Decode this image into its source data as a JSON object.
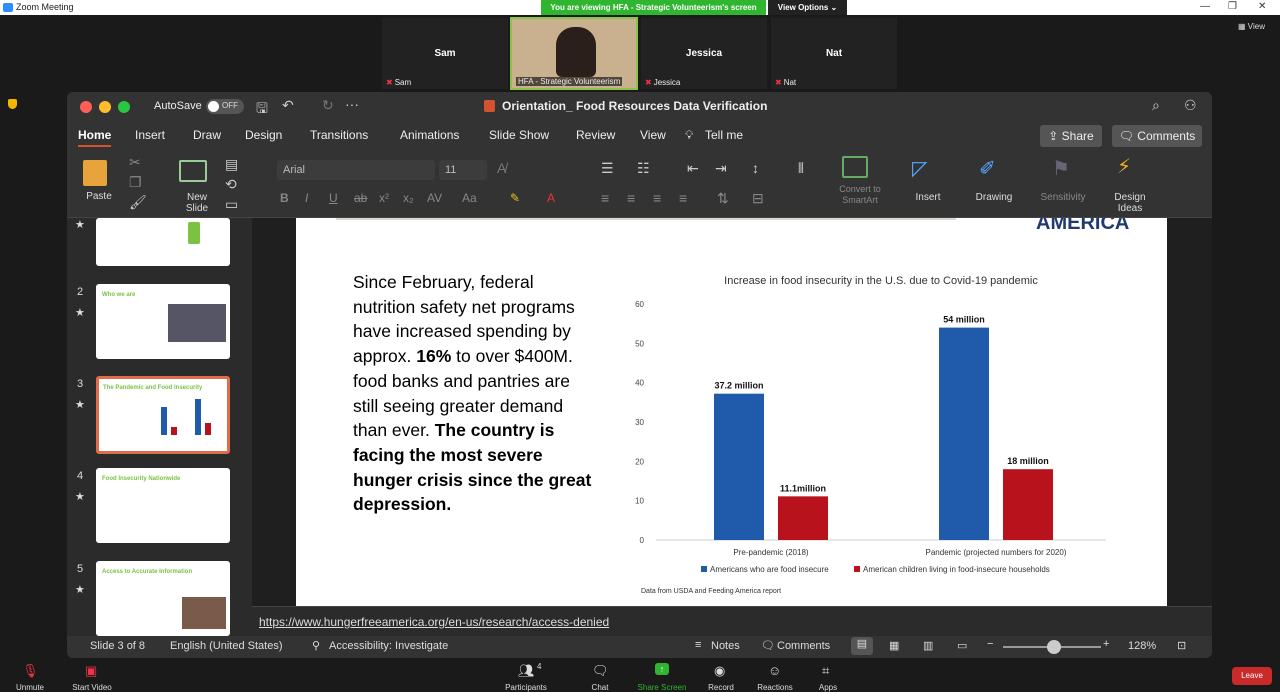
{
  "zoom": {
    "title": "Zoom Meeting",
    "banner": "You are viewing HFA - Strategic Volunteerism's screen",
    "view_options": "View Options",
    "view": "View",
    "participants": [
      {
        "name": "Sam",
        "label": "Sam"
      },
      {
        "name": "",
        "label": "HFA - Strategic Volunteerism"
      },
      {
        "name": "Jessica",
        "label": "Jessica"
      },
      {
        "name": "Nat",
        "label": "Nat"
      }
    ],
    "controls": {
      "unmute": "Unmute",
      "start_video": "Start Video",
      "participants": "Participants",
      "participants_count": "4",
      "chat": "Chat",
      "share": "Share Screen",
      "record": "Record",
      "reactions": "Reactions",
      "apps": "Apps",
      "leave": "Leave"
    }
  },
  "ppt": {
    "autosave": "AutoSave",
    "autosave_state": "OFF",
    "doc_title": "Orientation_ Food Resources Data Verification",
    "tabs": [
      "Home",
      "Insert",
      "Draw",
      "Design",
      "Transitions",
      "Animations",
      "Slide Show",
      "Review",
      "View"
    ],
    "tell_me": "Tell me",
    "share": "Share",
    "comments": "Comments",
    "ribbon": {
      "paste": "Paste",
      "new_slide": "New Slide",
      "font": "Arial",
      "size": "11",
      "convert": "Convert to SmartArt",
      "insert": "Insert",
      "drawing": "Drawing",
      "sensitivity": "Sensitivity",
      "design_ideas": "Design Ideas"
    },
    "thumbs": [
      {
        "num": "2",
        "title": "Who we are"
      },
      {
        "num": "3",
        "title": "The Pandemic and Food Insecurity"
      },
      {
        "num": "4",
        "title": "Food Insecurity Nationwide"
      },
      {
        "num": "5",
        "title": "Access to Accurate Information"
      }
    ],
    "slide": {
      "logo": "AMERICA",
      "text_normal1": "Since February, federal nutrition safety net programs have increased spending by approx. ",
      "text_bold1": "16%",
      "text_normal2": " to over $400M. food banks and pantries are still seeing greater demand than ever. ",
      "text_bold2": "The country is facing the most severe hunger crisis since the great depression.",
      "source": "Data from USDA and Feeding America report"
    },
    "notes_link": "https://www.hungerfreeamerica.org/en-us/research/access-denied",
    "status": {
      "slide": "Slide 3 of 8",
      "lang": "English (United States)",
      "access": "Accessibility: Investigate",
      "notes": "Notes",
      "comments": "Comments",
      "zoom": "128%"
    }
  },
  "chart_data": {
    "type": "bar",
    "title": "Increase in food insecurity in the U.S. due to Covid-19 pandemic",
    "categories": [
      "Pre-pandemic (2018)",
      "Pandemic (projected numbers for 2020)"
    ],
    "series": [
      {
        "name": "Americans who are food insecure",
        "values": [
          37.2,
          54
        ],
        "labels": [
          "37.2 million",
          "54 million"
        ],
        "color": "#1f5baa"
      },
      {
        "name": "American children living in food-insecure households",
        "values": [
          11.1,
          18
        ],
        "labels": [
          "11.1million",
          "18 million"
        ],
        "color": "#b8131c"
      }
    ],
    "ylim": [
      0,
      60
    ],
    "yticks": [
      0,
      10,
      20,
      30,
      40,
      50,
      60
    ],
    "legend": "bottom",
    "grid": false
  }
}
